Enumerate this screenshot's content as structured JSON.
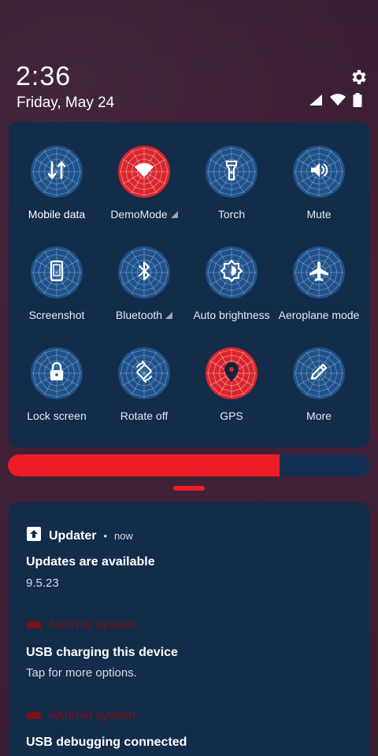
{
  "status_bar": {
    "time": "2:36",
    "date": "Friday, May 24",
    "icons": [
      "signal-icon",
      "wifi-icon",
      "battery-icon"
    ]
  },
  "quick_settings": {
    "tiles": [
      {
        "label": "Mobile data",
        "icon": "mobile-data-icon",
        "state": "off",
        "active_label": true
      },
      {
        "label": "DemoMode",
        "icon": "wifi-icon",
        "state": "on",
        "has_detail": true
      },
      {
        "label": "Torch",
        "icon": "flashlight-icon",
        "state": "off"
      },
      {
        "label": "Mute",
        "icon": "volume-icon",
        "state": "off"
      },
      {
        "label": "Screenshot",
        "icon": "phone-icon",
        "state": "off"
      },
      {
        "label": "Bluetooth",
        "icon": "bluetooth-icon",
        "state": "off",
        "has_detail": true
      },
      {
        "label": "Auto brightness",
        "icon": "brightness-icon",
        "state": "off"
      },
      {
        "label": "Aeroplane mode",
        "icon": "airplane-icon",
        "state": "off"
      },
      {
        "label": "Lock screen",
        "icon": "lock-icon",
        "state": "off"
      },
      {
        "label": "Rotate off",
        "icon": "rotate-icon",
        "state": "off"
      },
      {
        "label": "GPS",
        "icon": "location-icon",
        "state": "on"
      },
      {
        "label": "More",
        "icon": "edit-icon",
        "state": "off"
      }
    ]
  },
  "brightness": {
    "level": 0.75
  },
  "notifications": [
    {
      "app": "Updater",
      "time": "now",
      "title": "Updates are available",
      "body": "9.5.23"
    },
    {
      "app": "Android system",
      "title": "USB charging this device",
      "body": "Tap for more options."
    },
    {
      "app": "Android system",
      "title": "USB debugging connected",
      "body": ""
    }
  ],
  "colors": {
    "accent": "#ee1c25",
    "panel": "#122c4a",
    "tile_off": "#20528a",
    "tile_on": "#d9262e",
    "background": "#3b1f33"
  }
}
